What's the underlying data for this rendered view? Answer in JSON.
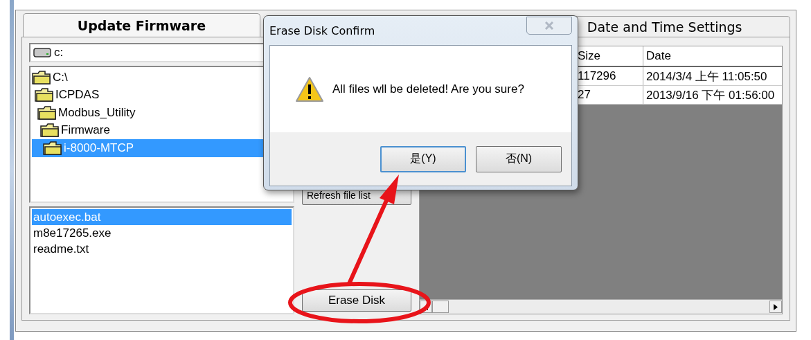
{
  "tabs": [
    {
      "label": "Update Firmware",
      "selected": true
    },
    {
      "label": "Date and Time Settings",
      "selected": false
    }
  ],
  "drive": {
    "value": "c:"
  },
  "folders": [
    {
      "name": "C:\\",
      "selected": false,
      "children": [
        {
          "name": "ICPDAS",
          "selected": false,
          "children": [
            {
              "name": "Modbus_Utility",
              "selected": false,
              "children": [
                {
                  "name": "Firmware",
                  "selected": false,
                  "children": [
                    {
                      "name": "i-8000-MTCP",
                      "selected": true
                    }
                  ]
                }
              ]
            }
          ]
        }
      ]
    }
  ],
  "files": [
    {
      "name": "autoexec.bat",
      "selected": true
    },
    {
      "name": "m8e17265.exe",
      "selected": false
    },
    {
      "name": "readme.txt",
      "selected": false
    }
  ],
  "buttons": {
    "refresh": "Refresh file list",
    "erase": "Erase Disk"
  },
  "file_table": {
    "columns": [
      "Size",
      "Date"
    ],
    "rows": [
      [
        "117296",
        "2014/3/4 上午 11:05:50"
      ],
      [
        "27",
        "2013/9/16 下午 01:56:00"
      ]
    ]
  },
  "dialog": {
    "title": "Erase Disk Confirm",
    "message": "All files wll be deleted! Are you sure?",
    "buttons": [
      {
        "label": "是(Y)",
        "focused": true
      },
      {
        "label": "否(N)",
        "focused": false
      }
    ]
  }
}
